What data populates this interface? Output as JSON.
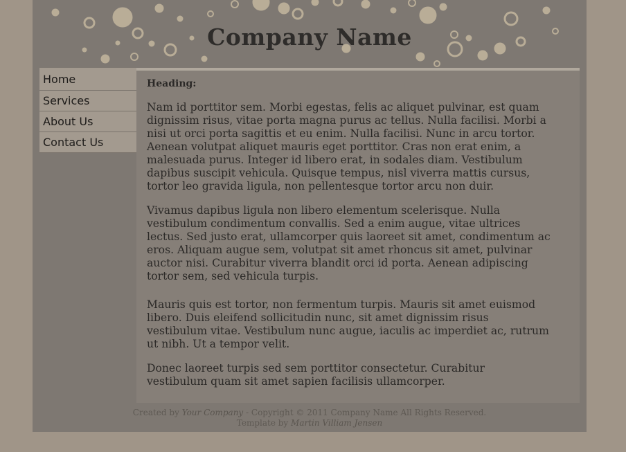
{
  "header": {
    "title": "Company Name"
  },
  "nav": {
    "items": [
      {
        "label": "Home"
      },
      {
        "label": "Services"
      },
      {
        "label": "About Us"
      },
      {
        "label": "Contact Us"
      }
    ]
  },
  "main": {
    "heading": "Heading:",
    "paragraphs": [
      {
        "lines": [
          "Nam id porttitor sem. Morbi egestas, felis ac aliquet pulvinar, est quam",
          "dignissim risus, vitae porta magna purus ac tellus. Nulla facilisi. Morbi a",
          "nisi ut orci porta sagittis et eu enim. Nulla facilisi. Nunc in arcu tortor.",
          "Aenean volutpat aliquet mauris eget porttitor. Cras non erat enim, a",
          "malesuada purus. Integer id libero erat, in sodales diam. Vestibulum",
          "dapibus suscipit vehicula. Quisque tempus, nisl viverra mattis cursus,",
          "tortor leo gravida ligula, non pellentesque tortor arcu non duir."
        ]
      },
      {
        "lines": [
          "Vivamus dapibus ligula non libero elementum scelerisque. Nulla",
          "vestibulum condimentum convallis. Sed a enim augue, vitae ultrices",
          "lectus. Sed justo erat, ullamcorper quis laoreet sit amet, condimentum ac",
          "eros. Aliquam augue sem, volutpat sit amet rhoncus sit amet, pulvinar",
          "auctor nisi. Curabitur viverra blandit orci id porta. Aenean adipiscing",
          "tortor sem, sed vehicula turpis."
        ]
      },
      {
        "lines": [
          "Mauris quis est tortor, non fermentum turpis. Mauris sit amet euismod",
          "libero. Duis eleifend sollicitudin nunc, sit amet dignissim risus",
          "vestibulum vitae. Vestibulum nunc augue, iaculis ac imperdiet ac, rutrum",
          "ut nibh. Ut a tempor velit."
        ]
      },
      {
        "lines": [
          "Donec laoreet turpis sed sem porttitor consectetur. Curabitur",
          "vestibulum quam sit amet sapien facilisis ullamcorper."
        ]
      }
    ]
  },
  "footer": {
    "created_prefix": "Created by",
    "company_link": "Your Company",
    "copyright": "- Copyright © 2011 Company Name All Rights Reserved.",
    "template_prefix": "Template by",
    "author_link": "Martin Villiam Jensen"
  },
  "colors": {
    "page_bg": "#a09588",
    "wrapper_bg": "#7e7872",
    "content_bg": "#867f78",
    "nav_bg": "#a39a8f",
    "bubble": "#b9ad97",
    "text": "#2b2927"
  }
}
